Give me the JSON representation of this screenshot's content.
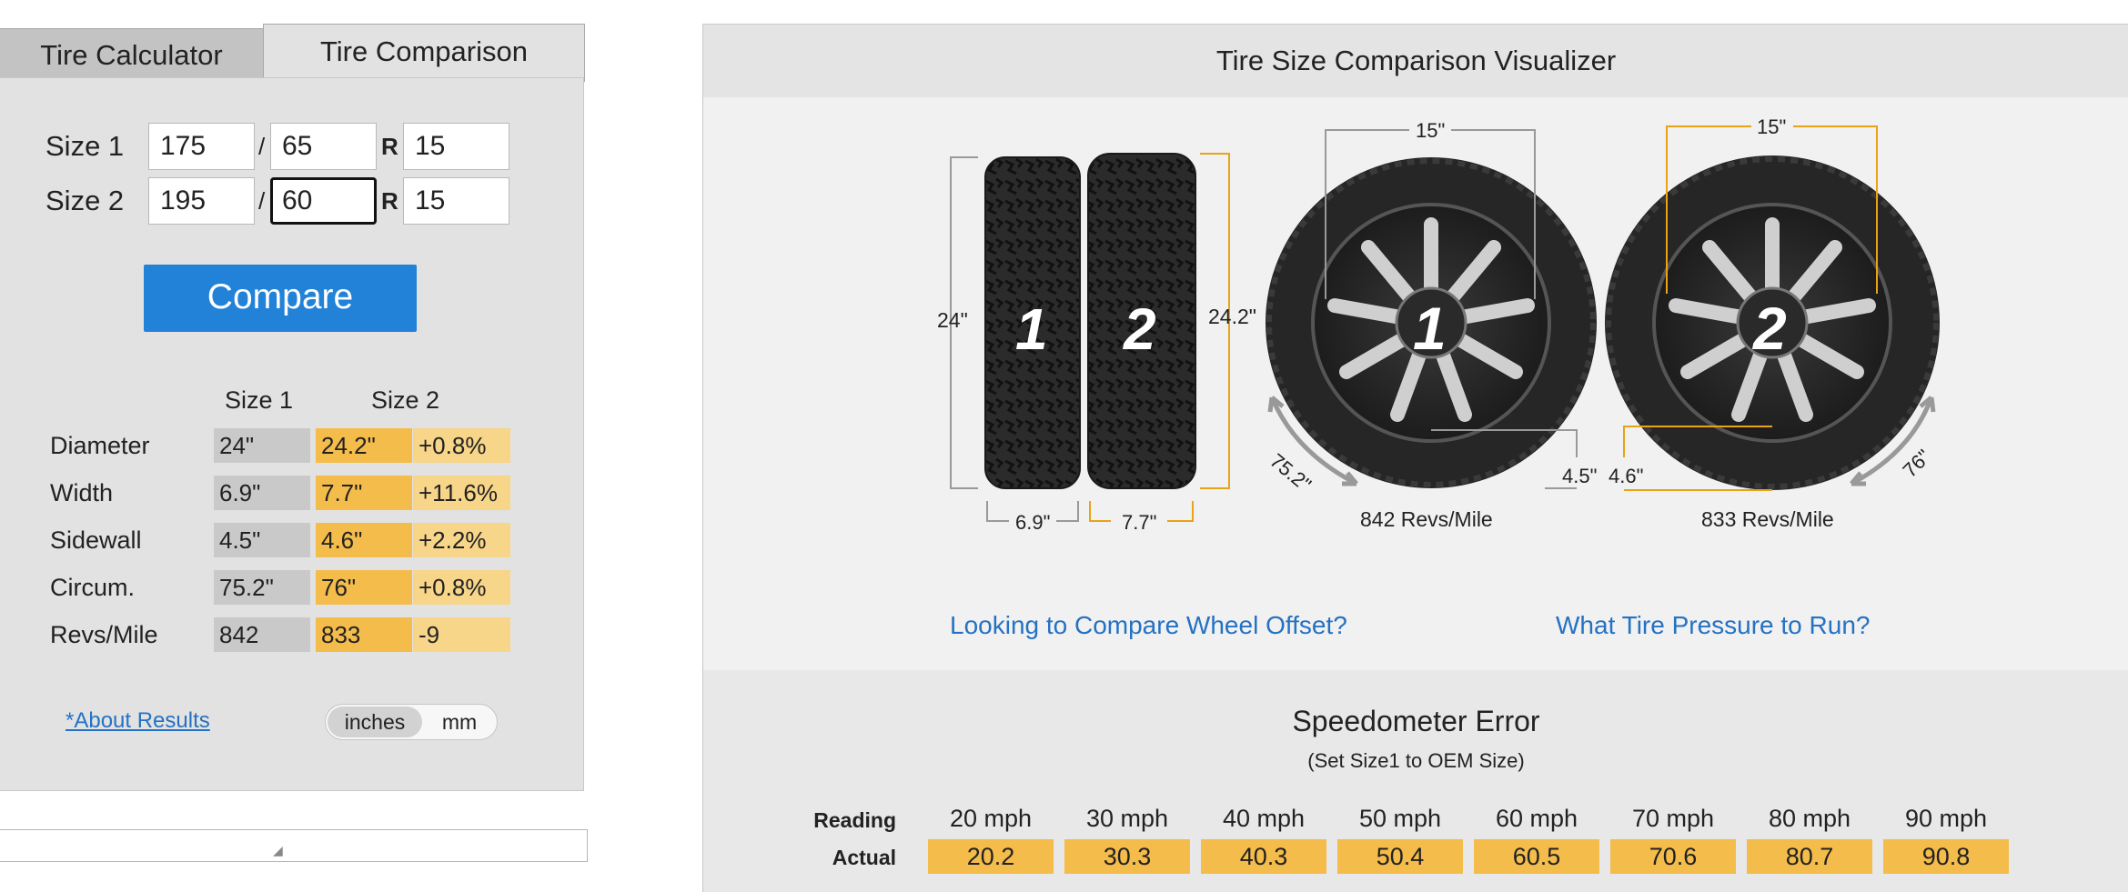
{
  "tabs": {
    "calculator": "Tire Calculator",
    "comparison": "Tire Comparison"
  },
  "inputs": {
    "size1": {
      "label": "Size 1",
      "width": "175",
      "aspect": "65",
      "rim": "15"
    },
    "size2": {
      "label": "Size 2",
      "width": "195",
      "aspect": "60",
      "rim": "15"
    },
    "slash": "/",
    "r": "R"
  },
  "compare_button": "Compare",
  "results": {
    "headers": [
      "Size 1",
      "Size 2"
    ],
    "rows": [
      {
        "label": "Diameter",
        "s1": "24\"",
        "s2": "24.2\"",
        "diff": "+0.8%"
      },
      {
        "label": "Width",
        "s1": "6.9\"",
        "s2": "7.7\"",
        "diff": "+11.6%"
      },
      {
        "label": "Sidewall",
        "s1": "4.5\"",
        "s2": "4.6\"",
        "diff": "+2.2%"
      },
      {
        "label": "Circum.",
        "s1": "75.2\"",
        "s2": "76\"",
        "diff": "+0.8%"
      },
      {
        "label": "Revs/Mile",
        "s1": "842",
        "s2": "833",
        "diff": "-9"
      }
    ]
  },
  "about_link": "*About Results",
  "units": {
    "inches": "inches",
    "mm": "mm",
    "selected": "inches"
  },
  "visualizer": {
    "title": "Tire Size Comparison Visualizer",
    "tire1": {
      "number": "1",
      "diameter": "24\"",
      "width": "6.9\"",
      "rim": "15\"",
      "sidewall": "4.5\"",
      "circumference": "75.2\"",
      "revs": "842 Revs/Mile"
    },
    "tire2": {
      "number": "2",
      "diameter": "24.2\"",
      "width": "7.7\"",
      "rim": "15\"",
      "sidewall": "4.6\"",
      "circumference": "76\"",
      "revs": "833 Revs/Mile"
    },
    "link_offset": "Looking to Compare Wheel Offset?",
    "link_pressure": "What Tire Pressure to Run?"
  },
  "speedometer": {
    "title": "Speedometer Error",
    "subtitle": "(Set Size1 to OEM Size)",
    "reading_label": "Reading",
    "actual_label": "Actual",
    "readings": [
      "20 mph",
      "30 mph",
      "40 mph",
      "50 mph",
      "60 mph",
      "70 mph",
      "80 mph",
      "90 mph"
    ],
    "actuals": [
      "20.2",
      "30.3",
      "40.3",
      "50.4",
      "60.5",
      "70.6",
      "80.7",
      "90.8"
    ]
  },
  "colors": {
    "accent": "#2182d8",
    "size2": "#f4bc4a",
    "diff": "#f7d589",
    "link": "#2472c4",
    "dim_orange": "#e8a317"
  }
}
